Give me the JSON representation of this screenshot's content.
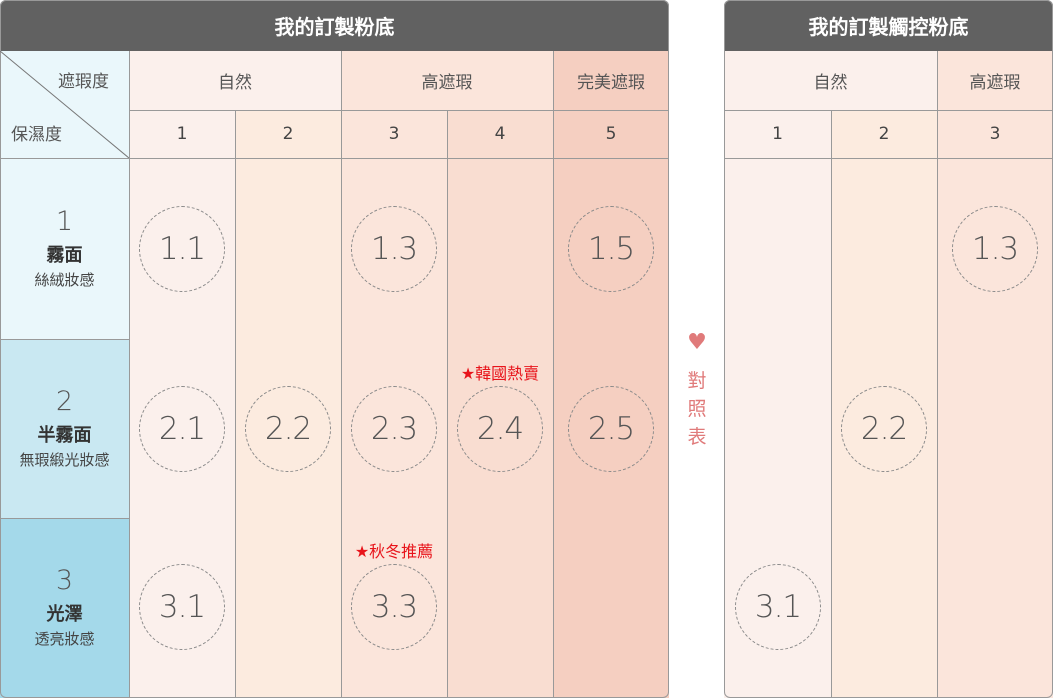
{
  "left": {
    "title": "我的訂製粉底",
    "corner": {
      "top": "遮瑕度",
      "bottom": "保濕度"
    },
    "groups": {
      "natural": "自然",
      "high": "高遮瑕",
      "perfect": "完美遮瑕"
    },
    "cols": [
      "1",
      "2",
      "3",
      "4",
      "5"
    ],
    "rows": [
      {
        "num": "1",
        "title": "霧面",
        "sub": "絲絨妝感"
      },
      {
        "num": "2",
        "title": "半霧面",
        "sub": "無瑕緞光妝感"
      },
      {
        "num": "3",
        "title": "光澤",
        "sub": "透亮妝感"
      }
    ],
    "circles": {
      "c11": "1.1",
      "c13": "1.3",
      "c15": "1.5",
      "c21": "2.1",
      "c22": "2.2",
      "c23": "2.3",
      "c24": "2.4",
      "c25": "2.5",
      "c31": "3.1",
      "c33": "3.3"
    },
    "badges": {
      "korea": "★韓國熱賣",
      "autumn": "★秋冬推薦"
    }
  },
  "middle": {
    "heart": "♥",
    "chars": [
      "對",
      "照",
      "表"
    ]
  },
  "right": {
    "title": "我的訂製觸控粉底",
    "groups": {
      "natural": "自然",
      "high": "高遮瑕"
    },
    "cols": [
      "1",
      "2",
      "3"
    ],
    "circles": {
      "c13": "1.3",
      "c22": "2.2",
      "c31": "3.1"
    }
  },
  "colors": {
    "header": "#616161",
    "col1": "#fbf0ec",
    "col2": "#fcebdf",
    "col3": "#fbe5db",
    "col4": "#f9ddd1",
    "col5": "#f5cfc1",
    "row1": "#eaf7fb",
    "row2": "#c9e8f2",
    "row3": "#a4d9ea",
    "heart": "#e07a7a",
    "badge": "#e8141b"
  }
}
